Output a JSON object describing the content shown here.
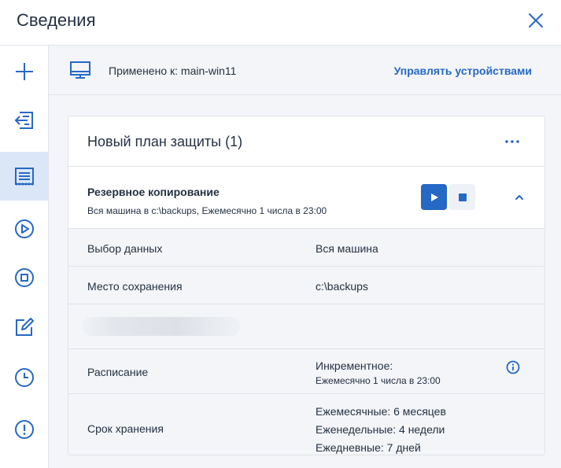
{
  "header": {
    "title": "Сведения"
  },
  "sidebar": {
    "items": [
      {
        "icon": "plus-icon"
      },
      {
        "icon": "import-icon"
      },
      {
        "icon": "list-icon",
        "active": true
      },
      {
        "icon": "play-circle-icon"
      },
      {
        "icon": "stop-circle-icon"
      },
      {
        "icon": "edit-icon"
      },
      {
        "icon": "clock-icon"
      },
      {
        "icon": "alert-circle-icon"
      }
    ]
  },
  "applied": {
    "label": "Применено к: main-win11",
    "manage_link": "Управлять устройствами"
  },
  "plan": {
    "title": "Новый план защиты (1)",
    "backup": {
      "name": "Резервное копирование",
      "description": "Вся машина в c:\\backups, Ежемесячно 1 числа в 23:00"
    },
    "details": {
      "data_selection": {
        "label": "Выбор данных",
        "value": "Вся машина"
      },
      "storage": {
        "label": "Место сохранения",
        "value": "c:\\backups"
      },
      "schedule": {
        "label": "Расписание",
        "value": "Инкрементное:",
        "sub": "Ежемесячно 1 числа в 23:00"
      },
      "retention": {
        "label": "Срок хранения",
        "values": [
          "Ежемесячные: 6 месяцев",
          "Еженедельные: 4 недели",
          "Ежедневные: 7 дней"
        ]
      }
    }
  },
  "colors": {
    "accent": "#2668c5",
    "text": "#243143",
    "panel": "#f3f5f8",
    "active": "#dbe7f7"
  }
}
